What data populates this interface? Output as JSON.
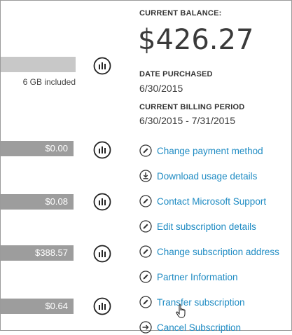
{
  "usage_bars": [
    {
      "value": "",
      "note": "6 GB included"
    },
    {
      "value": "$0.00"
    },
    {
      "value": "$0.08"
    },
    {
      "value": "$388.57"
    },
    {
      "value": "$0.64"
    }
  ],
  "summary": {
    "current_balance_label": "CURRENT BALANCE:",
    "current_balance": "$426.27",
    "date_purchased_label": "DATE PURCHASED",
    "date_purchased": "6/30/2015",
    "billing_period_label": "CURRENT BILLING PERIOD",
    "billing_period": "6/30/2015 - 7/31/2015"
  },
  "actions": [
    {
      "label": "Change payment method",
      "icon": "pencil-icon"
    },
    {
      "label": "Download usage details",
      "icon": "download-icon"
    },
    {
      "label": "Contact Microsoft Support",
      "icon": "pencil-icon"
    },
    {
      "label": "Edit subscription details",
      "icon": "pencil-icon"
    },
    {
      "label": "Change subscription address",
      "icon": "pencil-icon"
    },
    {
      "label": "Partner Information",
      "icon": "pencil-icon"
    },
    {
      "label": "Transfer subscription",
      "icon": "pencil-icon"
    },
    {
      "label": "Cancel Subscription",
      "icon": "arrow-right-icon"
    }
  ],
  "colors": {
    "link": "#1e8bc3",
    "bar_dark": "#9d9d9d",
    "bar_light": "#c8c8c8"
  }
}
